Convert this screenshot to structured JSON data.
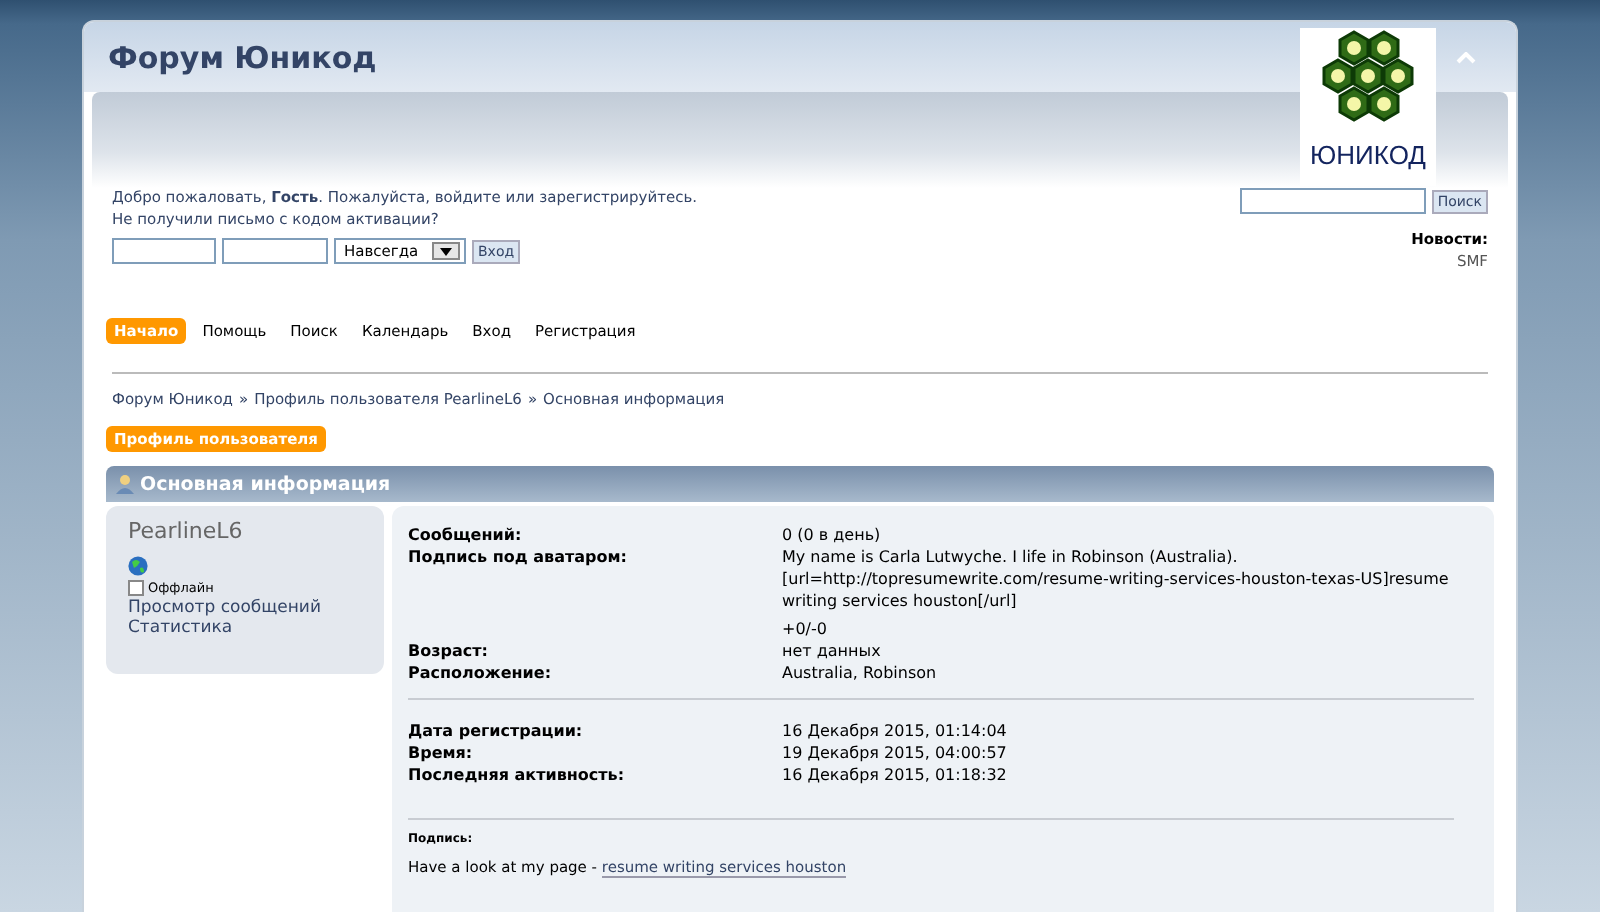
{
  "forum_title": "Форум Юникод",
  "logo": {
    "text": "ЮНИКОД"
  },
  "welcome": "Добро пожаловать, **Гость**. Пожалуйста, войдите или зарегистрируйтесь.",
  "activation": "Не получили письмо с кодом активации?",
  "login": {
    "duration": "Навсегда",
    "button": "Вход"
  },
  "search": {
    "button": "Поиск"
  },
  "news": {
    "title": "Новости:",
    "text": "SMF"
  },
  "menu": [
    {
      "label": "Начало",
      "selected": true
    },
    {
      "label": "Помощь",
      "selected": false
    },
    {
      "label": "Поиск",
      "selected": false
    },
    {
      "label": "Календарь",
      "selected": false
    },
    {
      "label": "Вход",
      "selected": false
    },
    {
      "label": "Регистрация",
      "selected": false
    }
  ],
  "breadcrumb": [
    "Форум Юникод",
    "Профиль пользователя PearlineL6",
    "Основная информация"
  ],
  "breadcrumb_separator": "»",
  "profile_tab": "Профиль пользователя",
  "section_title": "Основная информация",
  "user": {
    "name": "PearlineL6",
    "online": false,
    "status": "Оффлайн",
    "links": [
      "Просмотр сообщений",
      "Статистика"
    ]
  },
  "groups": [
    {
      "rows": [
        {
          "label": "Сообщений:",
          "value": "0 (0 в день)"
        },
        {
          "label": "Подпись под аватаром:",
          "value": "My name is Carla Lutwyche. I life in Robinson (Australia). [url=http://topresumewrite.com/resume-writing-services-houston-texas-US]resume writing services houston[/url]",
          "extra": "+0/-0"
        },
        {
          "label": "Возраст:",
          "value": "нет данных"
        },
        {
          "label": "Расположение:",
          "value": "Australia, Robinson"
        }
      ]
    },
    {
      "rows": [
        {
          "label": "Дата регистрации:",
          "value": "16 Декабря 2015, 01:14:04"
        },
        {
          "label": "Время:",
          "value": "19 Декабря 2015, 04:00:57"
        },
        {
          "label": "Последняя активность:",
          "value": "16 Декабря 2015, 01:18:32"
        }
      ]
    }
  ],
  "signature": {
    "title": "Подпись:",
    "text": "Have a look at my page - ",
    "link": "resume writing services houston"
  }
}
